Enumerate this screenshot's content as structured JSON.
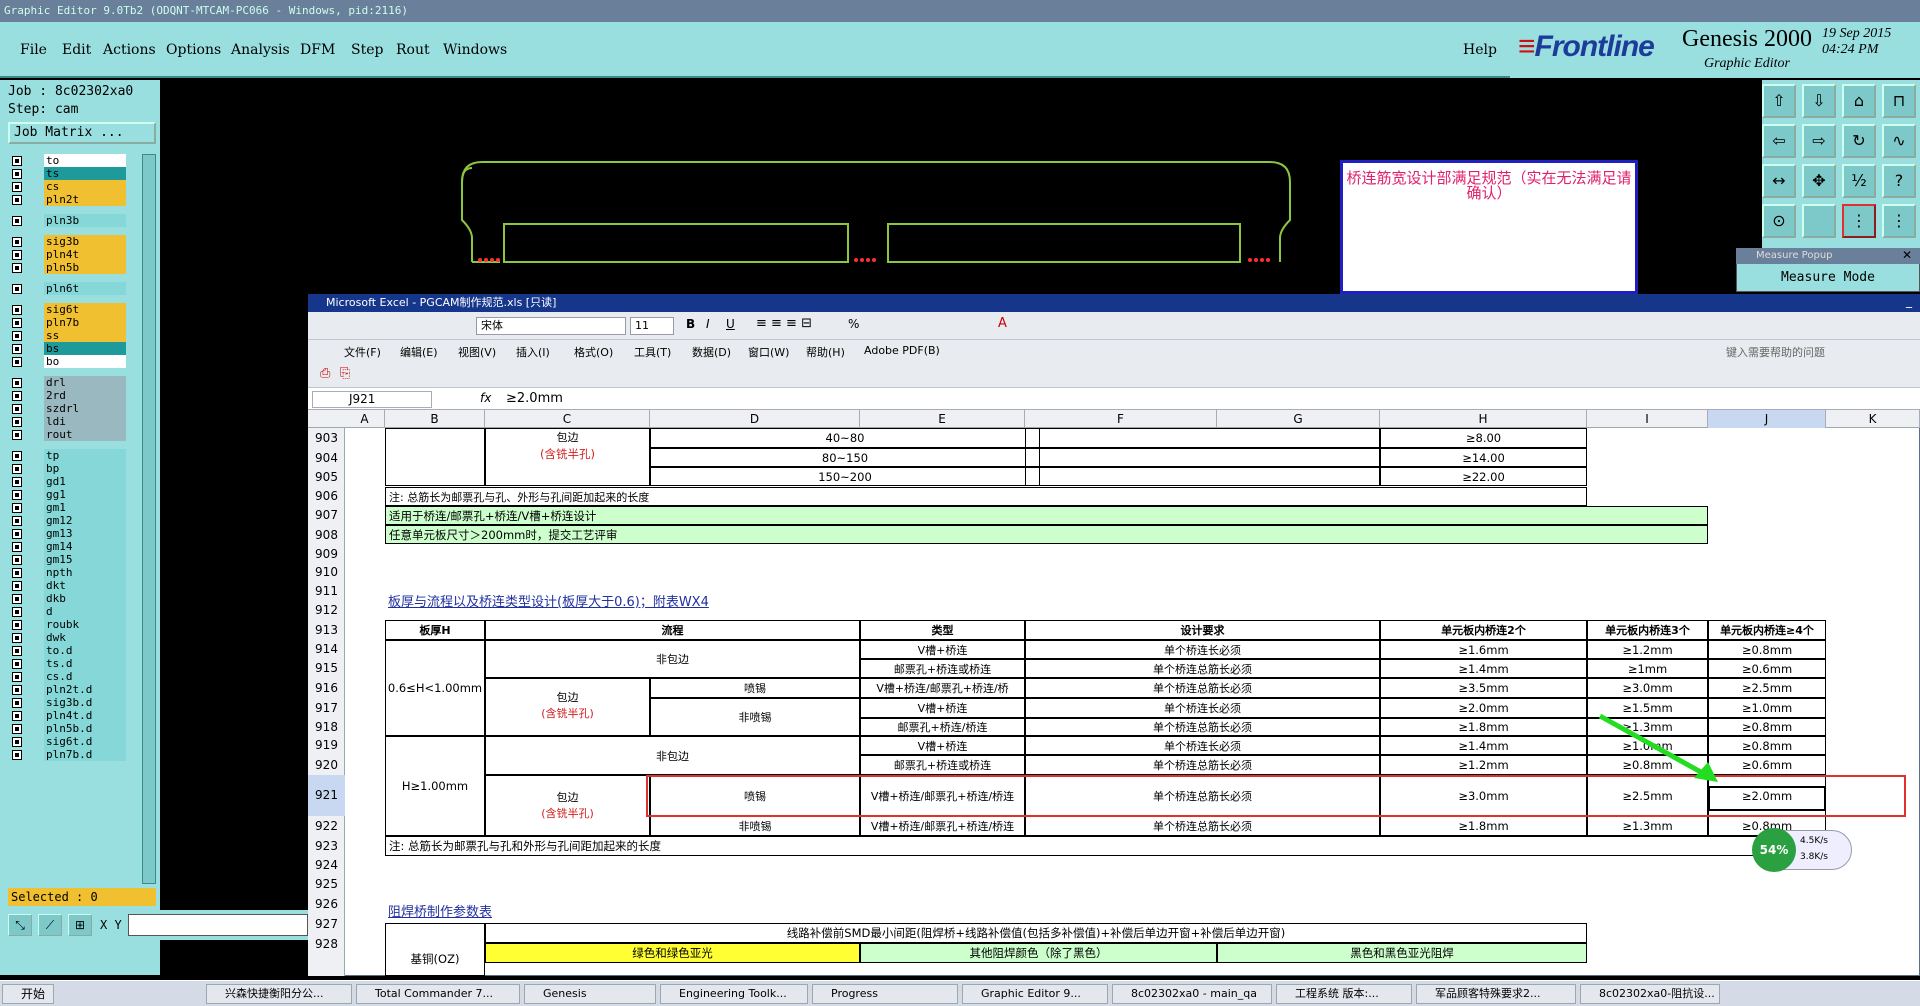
{
  "window_title": "Graphic Editor 9.0Tb2 (ODQNT-MTCAM-PC066 - Windows, pid:2116)",
  "menu": {
    "file": "File",
    "edit": "Edit",
    "actions": "Actions",
    "options": "Options",
    "analysis": "Analysis",
    "dfm": "DFM",
    "step": "Step",
    "rout": "Rout",
    "windows": "Windows",
    "help": "Help"
  },
  "brand": {
    "frontline": "Frontline",
    "product": "Genesis 2000",
    "subtitle": "Graphic Editor",
    "date": "19 Sep 2015",
    "time": "04:24 PM"
  },
  "job": {
    "job_label": "Job : 8c02302xa0",
    "step_label": "Step: cam",
    "matrix_button": "Job Matrix ..."
  },
  "layers": [
    {
      "name": "to",
      "style": "white"
    },
    {
      "name": "ts",
      "style": "green"
    },
    {
      "name": "cs",
      "style": "yellow"
    },
    {
      "name": "pln2t",
      "style": "yellow"
    },
    {
      "name": "pln3b",
      "style": "cyan"
    },
    {
      "name": "sig3b",
      "style": "yellow"
    },
    {
      "name": "pln4t",
      "style": "yellow"
    },
    {
      "name": "pln5b",
      "style": "yellow"
    },
    {
      "name": "pln6t",
      "style": "cyan"
    },
    {
      "name": "sig6t",
      "style": "yellow"
    },
    {
      "name": "pln7b",
      "style": "yellow"
    },
    {
      "name": "ss",
      "style": "yellow"
    },
    {
      "name": "bs",
      "style": "green"
    },
    {
      "name": "bo",
      "style": "white"
    },
    {
      "name": "drl",
      "style": "gray"
    },
    {
      "name": "2rd",
      "style": "gray"
    },
    {
      "name": "szdrl",
      "style": "gray"
    },
    {
      "name": "ldi",
      "style": "gray"
    },
    {
      "name": "rout",
      "style": "gray"
    },
    {
      "name": "tp",
      "style": "cyan"
    },
    {
      "name": "bp",
      "style": "cyan"
    },
    {
      "name": "gd1",
      "style": "cyan"
    },
    {
      "name": "gg1",
      "style": "cyan"
    },
    {
      "name": "gm1",
      "style": "cyan"
    },
    {
      "name": "gm12",
      "style": "cyan"
    },
    {
      "name": "gm13",
      "style": "cyan"
    },
    {
      "name": "gm14",
      "style": "cyan"
    },
    {
      "name": "gm15",
      "style": "cyan"
    },
    {
      "name": "npth",
      "style": "cyan"
    },
    {
      "name": "dkt",
      "style": "cyan"
    },
    {
      "name": "dkb",
      "style": "cyan"
    },
    {
      "name": "d",
      "style": "cyan"
    },
    {
      "name": "roubk",
      "style": "cyan"
    },
    {
      "name": "dwk",
      "style": "cyan"
    },
    {
      "name": "to.d",
      "style": "cyan"
    },
    {
      "name": "ts.d",
      "style": "cyan"
    },
    {
      "name": "cs.d",
      "style": "cyan"
    },
    {
      "name": "pln2t.d",
      "style": "cyan"
    },
    {
      "name": "sig3b.d",
      "style": "cyan"
    },
    {
      "name": "pln4t.d",
      "style": "cyan"
    },
    {
      "name": "pln5b.d",
      "style": "cyan"
    },
    {
      "name": "sig6t.d",
      "style": "cyan"
    },
    {
      "name": "pln7b.d",
      "style": "cyan"
    }
  ],
  "selected_label": "Selected : 0",
  "xy_label": "X Y :",
  "note_text": "桥连筋宽设计部满足规范（实在无法满足请确认）",
  "measure": {
    "title": "Measure Popup",
    "mode": "Measure Mode"
  },
  "excel": {
    "title": "Microsoft Excel - PGCAM制作规范.xls  [只读]",
    "font": "宋体",
    "size": "11",
    "menus": [
      "文件(F)",
      "编辑(E)",
      "视图(V)",
      "插入(I)",
      "格式(O)",
      "工具(T)",
      "数据(D)",
      "窗口(W)",
      "帮助(H)",
      "Adobe PDF(B)"
    ],
    "help_placeholder": "键入需要帮助的问题",
    "name_box": "J921",
    "fx": "fx",
    "formula": "≥2.0mm",
    "columns": [
      "A",
      "B",
      "C",
      "D",
      "E",
      "F",
      "G",
      "H",
      "I",
      "J",
      "K"
    ],
    "rows": [
      "903",
      "904",
      "905",
      "906",
      "907",
      "908",
      "909",
      "910",
      "911",
      "912",
      "913",
      "914",
      "915",
      "916",
      "917",
      "918",
      "919",
      "920",
      "921",
      "922",
      "923",
      "924",
      "925",
      "926",
      "927",
      "928"
    ],
    "r903_c": "包边",
    "r903_c2": "(含铣半孔)",
    "r903": [
      "40~80",
      "≥8.00"
    ],
    "r904": [
      "80~150",
      "≥14.00"
    ],
    "r905": [
      "150~200",
      "≥22.00"
    ],
    "r906": "注: 总筋长为邮票孔与孔、外形与孔间距加起来的长度",
    "r907": "适用于桥连/邮票孔+桥连/V槽+桥连设计",
    "r908": "任意单元板尺寸＞200mm时，提交工艺评审",
    "r911": "板厚与流程以及桥连类型设计(板厚大于0.6)；附表WX4",
    "hdr": [
      "板厚H",
      "流程",
      "类型",
      "设计要求",
      "单元板内桥连2个",
      "单元板内桥连3个",
      "单元板内桥连≥4个"
    ],
    "thick1": "0.6≤H<1.00mm",
    "thick2": "H≥1.00mm",
    "nonbaobian": "非包边",
    "baobian": "包边",
    "hanxi": "(含铣半孔)",
    "penxi": "喷锡",
    "feipenxi": "非喷锡",
    "t1": [
      [
        "V槽+桥连",
        "单个桥连长必须",
        "≥1.6mm",
        "≥1.2mm",
        "≥0.8mm"
      ],
      [
        "邮票孔+桥连或桥连",
        "单个桥连总筋长必须",
        "≥1.4mm",
        "≥1mm",
        "≥0.6mm"
      ],
      [
        "V槽+桥连/邮票孔+桥连/桥",
        "单个桥连总筋长必须",
        "≥3.5mm",
        "≥3.0mm",
        "≥2.5mm"
      ],
      [
        "V槽+桥连",
        "单个桥连长必须",
        "≥2.0mm",
        "≥1.5mm",
        "≥1.0mm"
      ],
      [
        "邮票孔+桥连/桥连",
        "单个桥连总筋长必须",
        "≥1.8mm",
        "≥1.3mm",
        "≥0.8mm"
      ]
    ],
    "t2": [
      [
        "V槽+桥连",
        "单个桥连长必须",
        "≥1.4mm",
        "≥1.0mm",
        "≥0.8mm"
      ],
      [
        "邮票孔+桥连或桥连",
        "单个桥连总筋长必须",
        "≥1.2mm",
        "≥0.8mm",
        "≥0.6mm"
      ],
      [
        "V槽+桥连/邮票孔+桥连/桥连",
        "单个桥连总筋长必须",
        "≥3.0mm",
        "≥2.5mm",
        "≥2.0mm"
      ],
      [
        "V槽+桥连/邮票孔+桥连/桥连",
        "单个桥连总筋长必须",
        "≥1.8mm",
        "≥1.3mm",
        "≥0.8mm"
      ]
    ],
    "r923": "注: 总筋长为邮票孔与孔和外形与孔间距加起来的长度",
    "r926": "阻焊桥制作参数表",
    "r927": "线路补偿前SMD最小间距(阻焊桥+线路补偿值(包括多补偿值)+补偿后单边开窗+补偿后单边开窗)",
    "r928_a": "基铜(OZ)",
    "r928_b": "绿色和绿色亚光",
    "r928_c": "其他阻焊颜色（除了黑色）",
    "r928_d": "黑色和黑色亚光阻焊"
  },
  "net": {
    "percent": "54%",
    "up": "4.5K/s",
    "down": "3.8K/s"
  },
  "taskbar": {
    "start": "开始",
    "tasks": [
      "兴森快捷衡阳分公...",
      "Total Commander 7...",
      "Genesis",
      "Engineering Toolk...",
      "Progress",
      "Graphic Editor 9...",
      "8c02302xa0 - main_qa",
      "工程系统  版本:...",
      "军品顾客特殊要求2...",
      "8c02302xa0-阻抗设..."
    ]
  }
}
